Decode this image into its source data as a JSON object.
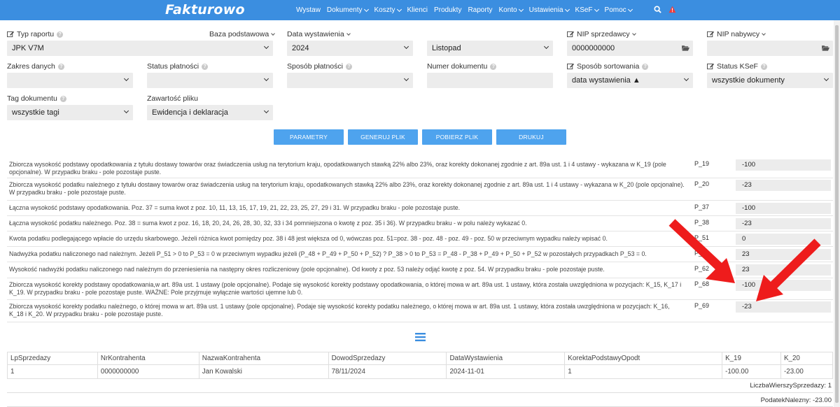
{
  "app": {
    "logo": "Fakturowo"
  },
  "nav": [
    {
      "label": "Wystaw",
      "dropdown": false
    },
    {
      "label": "Dokumenty",
      "dropdown": true
    },
    {
      "label": "Koszty",
      "dropdown": true
    },
    {
      "label": "Klienci",
      "dropdown": false
    },
    {
      "label": "Produkty",
      "dropdown": false
    },
    {
      "label": "Raporty",
      "dropdown": false
    },
    {
      "label": "Konto",
      "dropdown": true
    },
    {
      "label": "Ustawienia",
      "dropdown": true
    },
    {
      "label": "KSeF",
      "dropdown": true
    },
    {
      "label": "Pomoc",
      "dropdown": true
    }
  ],
  "filters": {
    "typ_raportu": {
      "label": "Typ raportu",
      "value": "JPK V7M"
    },
    "baza": {
      "label": "Baza podstawowa"
    },
    "data_wystawienia": {
      "label": "Data wystawienia",
      "year": "2024",
      "month": "Listopad"
    },
    "nip_sprzedawcy": {
      "label": "NIP sprzedawcy",
      "value": "0000000000"
    },
    "nip_nabywcy": {
      "label": "NIP nabywcy",
      "value": ""
    },
    "zakres_danych": {
      "label": "Zakres danych",
      "value": ""
    },
    "status_platnosci": {
      "label": "Status płatności",
      "value": ""
    },
    "sposob_platnosci": {
      "label": "Sposób płatności",
      "value": ""
    },
    "numer_dokumentu": {
      "label": "Numer dokumentu",
      "value": ""
    },
    "sposob_sortowania": {
      "label": "Sposób sortowania",
      "value": "data wystawienia ▲"
    },
    "status_ksef": {
      "label": "Status KSeF",
      "value": "wszystkie dokumenty"
    },
    "tag_dokumentu": {
      "label": "Tag dokumentu",
      "value": "wszystkie tagi"
    },
    "zawartosc_pliku": {
      "label": "Zawartość pliku",
      "value": "Ewidencja i deklaracja"
    }
  },
  "buttons": {
    "parametry": "PARAMETRY",
    "generuj": "GENERUJ PLIK",
    "pobierz": "POBIERZ PLIK",
    "drukuj": "DRUKUJ"
  },
  "rows": [
    {
      "text": "Zbiorcza wysokość podstawy opodatkowania z tytułu dostawy towarów oraz świadczenia usług na terytorium kraju, opodatkowanych stawką 22% albo 23%, oraz korekty dokonanej zgodnie z art. 89a ust. 1 i 4 ustawy - wykazana w K_19 (pole opcjonalne). W przypadku braku - pole pozostaje puste.",
      "code": "P_19",
      "value": "-100"
    },
    {
      "text": "Zbiorcza wysokość podatku należnego z tytułu dostawy towarów oraz świadczenia usług na terytorium kraju, opodatkowanych stawką 22% albo 23%, oraz korekty dokonanej zgodnie z art. 89a ust. 1 i 4 ustawy - wykazana w K_20 (pole opcjonalne). W przypadku braku - pole pozostaje puste.",
      "code": "P_20",
      "value": "-23"
    },
    {
      "text": "Łączna wysokość podstawy opodatkowania. Poz. 37 = suma kwot z poz. 10, 11, 13, 15, 17, 19, 21, 22, 23, 25, 27, 29 i 31. W przypadku braku - pole pozostaje puste.",
      "code": "P_37",
      "value": "-100"
    },
    {
      "text": "Łączna wysokość podatku należnego. Poz. 38 = suma kwot z poz. 16, 18, 20, 24, 26, 28, 30, 32, 33 i 34 pomniejszona o kwotę z poz. 35 i 36). W przypadku braku - w polu należy wykazać 0.",
      "code": "P_38",
      "value": "-23"
    },
    {
      "text": "Kwota podatku podlegającego wpłacie do urzędu skarbowego. Jeżeli różnica kwot pomiędzy poz. 38 i 48 jest większa od 0, wówczas poz. 51=poz. 38 - poz. 48 - poz. 49 - poz. 50 w przeciwnym wypadku należy wpisać 0.",
      "code": "P_51",
      "value": "0"
    },
    {
      "text": "Nadwyżka podatku naliczonego nad należnym. Jeżeli P_51 > 0 to P_53 = 0 w przeciwnym wypadku jeżeli (P_48 + P_49 + P_50 + P_52) ? P_38 > 0 to P_53 = P_48 - P_38 + P_49 + P_50 + P_52 w pozostałych przypadkach P_53 = 0.",
      "code": "P_53",
      "value": "23"
    },
    {
      "text": "Wysokość nadwyżki podatku naliczonego nad należnym do przeniesienia na następny okres rozliczeniowy (pole opcjonalne). Od kwoty z poz. 53 należy odjąć kwotę z poz. 54. W przypadku braku - pole pozostaje puste.",
      "code": "P_62",
      "value": "23"
    },
    {
      "text": "Zbiorcza wysokość korekty podstawy opodatkowania,w art. 89a ust. 1 ustawy (pole opcjonalne). Podaje się wysokość korekty podstawy opodatkowania, o której mowa w art. 89a ust. 1 ustawy, która została uwzględniona w pozycjach: K_15, K_17 i K_19. W przypadku braku - pole pozostaje puste. WAŻNE: Pole przyjmuje wyłącznie wartości ujemne lub 0.",
      "code": "P_68",
      "value": "-100"
    },
    {
      "text": "Zbiorcza wysokość korekty podatku należnego, o której mowa w art. 89a ust. 1 ustawy (pole opcjonalne). Podaje się wysokość korekty podatku należnego, o której mowa w art. 89a ust. 1 ustawy, która została uwzględniona w pozycjach: K_16, K_18 i K_20. W przypadku braku - pole pozostaje puste.",
      "code": "P_69",
      "value": "-23"
    }
  ],
  "table": {
    "headers": [
      "LpSprzedazy",
      "NrKontrahenta",
      "NazwaKontrahenta",
      "DowodSprzedazy",
      "DataWystawienia",
      "KorektaPodstawyOpodt",
      "K_19",
      "K_20"
    ],
    "rows": [
      [
        "1",
        "0000000000",
        "Jan Kowalski",
        "78/11/2024",
        "2024-11-01",
        "1",
        "-100.00",
        "-23.00"
      ]
    ],
    "footer1": "LiczbaWierszySprzedazy: 1",
    "footer2": "PodatekNalezny: -23.00"
  },
  "colors": {
    "nav": "#3b8ee0",
    "button": "#4ea3ee",
    "arrow": "#ee1c1c"
  }
}
